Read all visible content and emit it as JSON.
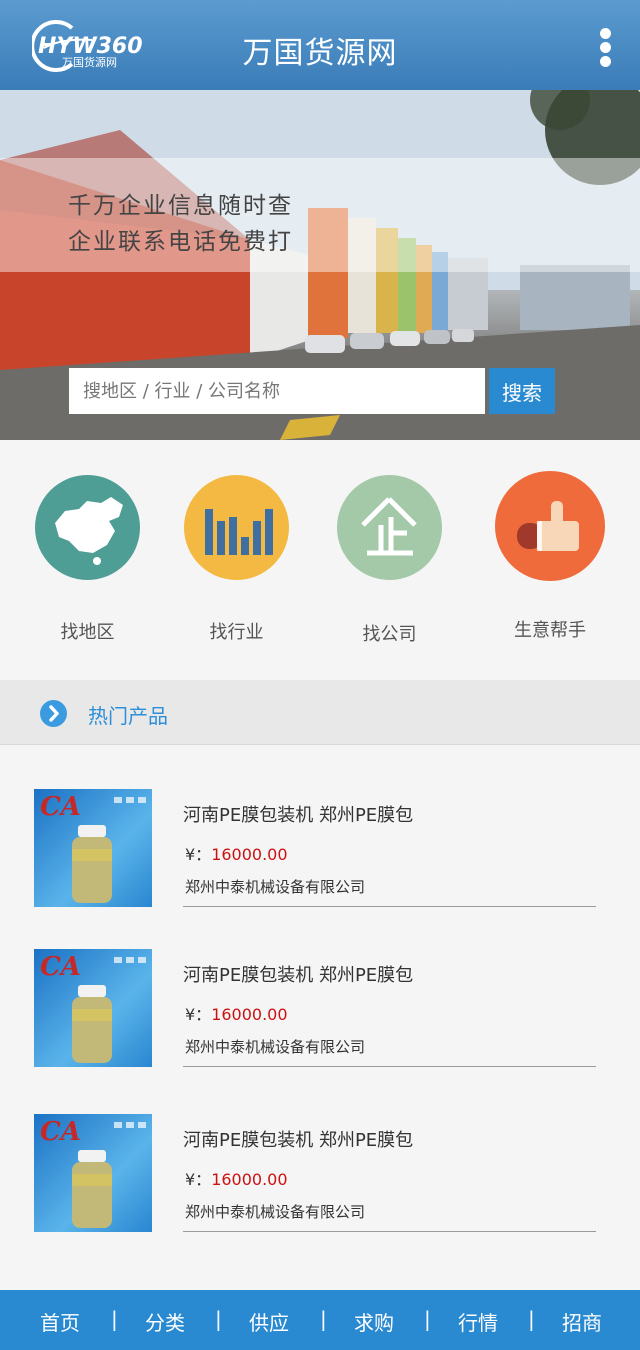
{
  "header": {
    "logo_text": "HYW360",
    "logo_sub": "万国货源网",
    "title": "万国货源网",
    "menu_icon": "vertical-dots-icon"
  },
  "hero": {
    "line1": "千万企业信息随时查",
    "line2": "企业联系电话免费打",
    "search_placeholder": "搜地区 / 行业 / 公司名称",
    "search_button": "搜索"
  },
  "categories": [
    {
      "label": "找地区",
      "icon": "china-map-icon",
      "color": "#4e9e96"
    },
    {
      "label": "找行业",
      "icon": "bar-chart-icon",
      "color": "#f4b942"
    },
    {
      "label": "找公司",
      "icon": "enterprise-icon",
      "color": "#a3c9a8"
    },
    {
      "label": "生意帮手",
      "icon": "thumbs-up-icon",
      "color": "#ef6b3c"
    }
  ],
  "section": {
    "title": "热门产品"
  },
  "products": [
    {
      "title": "河南PE膜包装机 郑州PE膜包",
      "currency": "¥：",
      "price": "16000.00",
      "company": "郑州中泰机械设备有限公司"
    },
    {
      "title": "河南PE膜包装机 郑州PE膜包",
      "currency": "¥：",
      "price": "16000.00",
      "company": "郑州中泰机械设备有限公司"
    },
    {
      "title": "河南PE膜包装机 郑州PE膜包",
      "currency": "¥：",
      "price": "16000.00",
      "company": "郑州中泰机械设备有限公司"
    }
  ],
  "bottom_nav": {
    "items": [
      "首页",
      "分类",
      "供应",
      "求购",
      "行情",
      "招商"
    ],
    "separator": "|"
  }
}
